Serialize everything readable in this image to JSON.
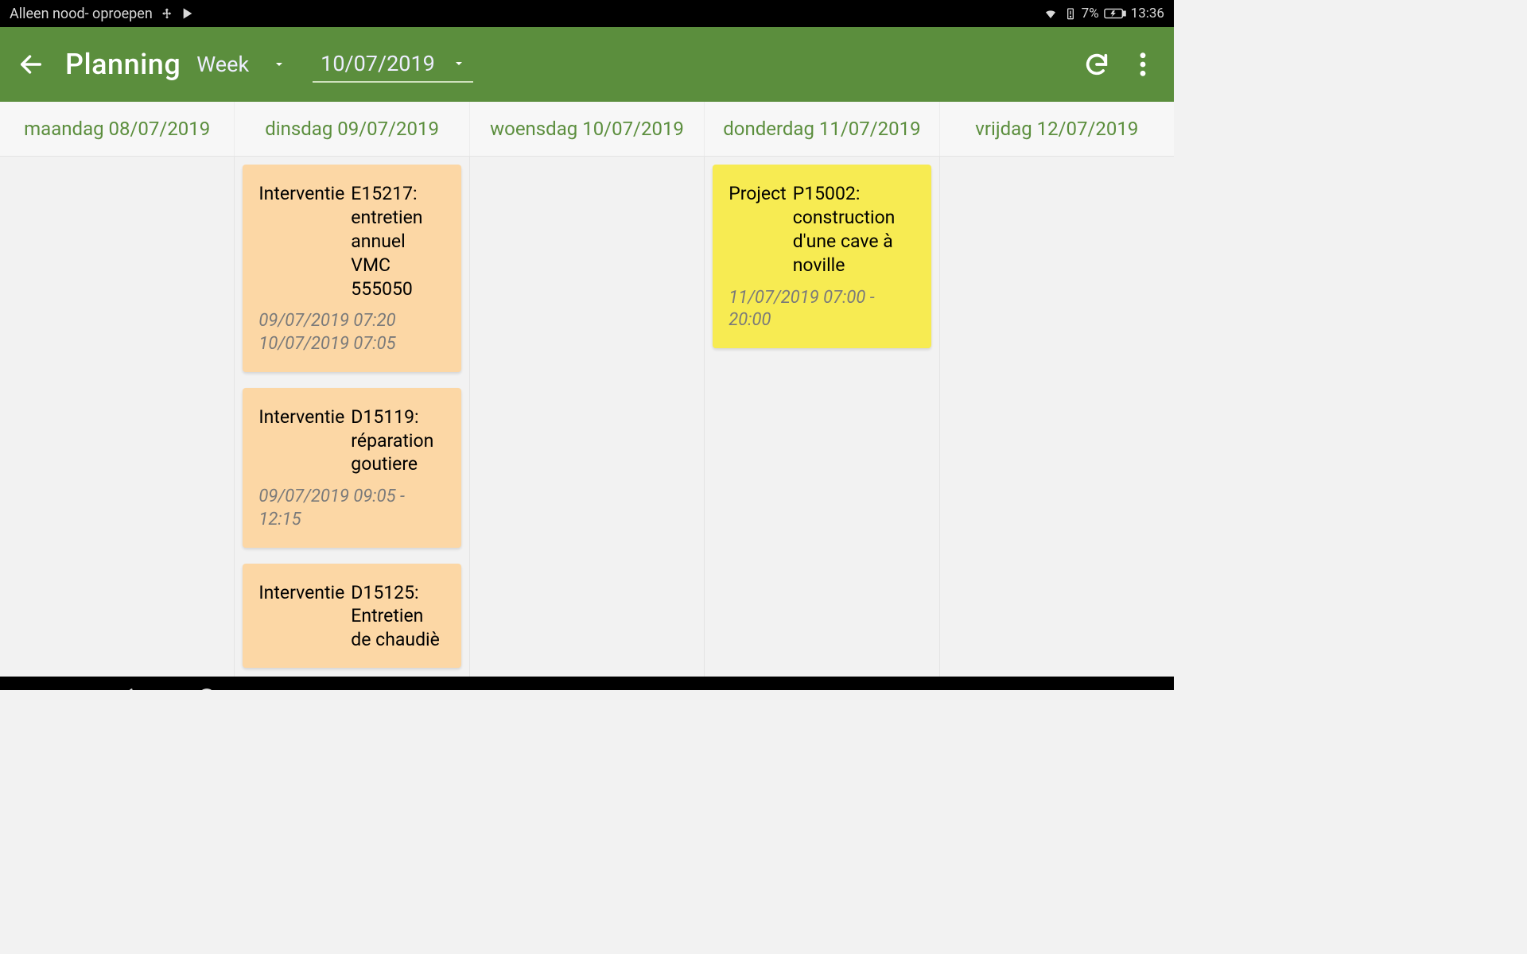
{
  "status": {
    "left_text": "Alleen nood- oproepen",
    "battery_pct": "7%",
    "time": "13:36"
  },
  "header": {
    "title": "Planning",
    "view_mode": "Week",
    "date": "10/07/2019"
  },
  "days": [
    {
      "label": "maandag 08/07/2019",
      "cards": []
    },
    {
      "label": "dinsdag 09/07/2019",
      "cards": [
        {
          "type": "Interventie",
          "desc": "E15217: entretien annuel VMC 555050",
          "time_lines": [
            "09/07/2019   07:20",
            "10/07/2019   07:05"
          ],
          "color": "orange"
        },
        {
          "type": "Interventie",
          "desc": "D15119: réparation goutiere",
          "time_lines": [
            "09/07/2019   09:05 - 12:15"
          ],
          "color": "orange"
        },
        {
          "type": "Interventie",
          "desc": "D15125: Entretien de chaudiè",
          "time_lines": [],
          "color": "orange"
        }
      ]
    },
    {
      "label": "woensdag 10/07/2019",
      "cards": []
    },
    {
      "label": "donderdag 11/07/2019",
      "cards": [
        {
          "type": "Project",
          "desc": "P15002: construction d'une cave à noville",
          "time_lines": [
            "11/07/2019   07:00 - 20:00"
          ],
          "color": "yellow"
        }
      ]
    },
    {
      "label": "vrijdag 12/07/2019",
      "cards": []
    }
  ]
}
